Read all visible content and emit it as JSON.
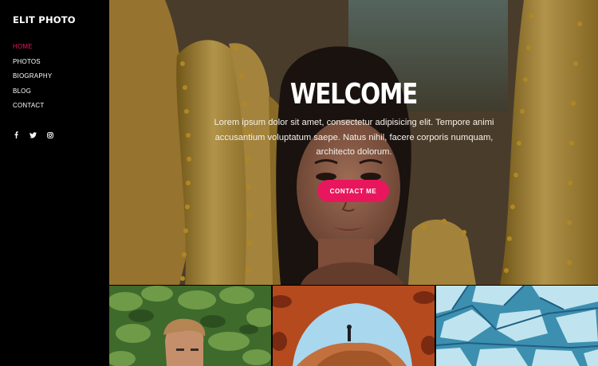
{
  "brand": {
    "name": "ELIT PHOTO"
  },
  "nav": {
    "items": [
      {
        "label": "HOME",
        "active": true
      },
      {
        "label": "PHOTOS",
        "active": false
      },
      {
        "label": "BIOGRAPHY",
        "active": false
      },
      {
        "label": "BLOG",
        "active": false
      },
      {
        "label": "CONTACT",
        "active": false
      }
    ]
  },
  "social": {
    "icons": [
      "facebook-icon",
      "twitter-icon",
      "instagram-icon"
    ]
  },
  "hero": {
    "title": "WELCOME",
    "text": "Lorem ipsum dolor sit amet, consectetur adipisicing elit. Tempore animi accusantium voluptatum saepe. Natus nihil, facere corporis numquam, architecto dolorum.",
    "cta_label": "CONTACT ME"
  },
  "colors": {
    "accent": "#e8175d",
    "sidebar": "#000000",
    "text": "#ffffff"
  },
  "gallery": {
    "thumbnails": [
      {
        "subject": "man in front of green foliage"
      },
      {
        "subject": "person standing under red rock arch"
      },
      {
        "subject": "aerial view of blue glacier ice"
      }
    ]
  }
}
